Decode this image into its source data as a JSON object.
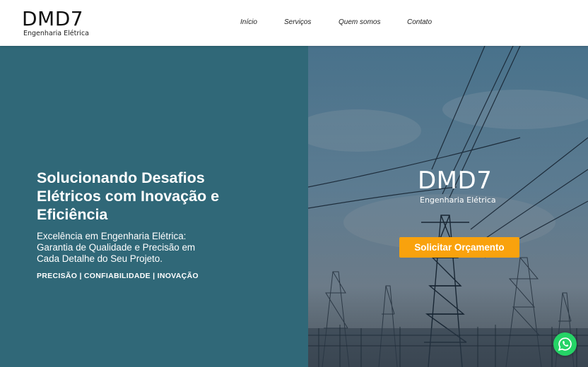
{
  "header": {
    "logo": {
      "title": "DMD7",
      "subtitle": "Engenharia Elétrica"
    },
    "nav": [
      {
        "label": "Início"
      },
      {
        "label": "Serviços"
      },
      {
        "label": "Quem somos"
      },
      {
        "label": "Contato"
      }
    ]
  },
  "hero": {
    "headline": "Solucionando Desafios Elétricos com Inovação e Eficiência",
    "subtext": "Excelência em Engenharia Elétrica: Garantia de Qualidade e Precisão em Cada Detalhe do Seu Projeto.",
    "tagline": "PRECISÃO | CONFIABILIDADE | INOVAÇÃO",
    "image_logo": {
      "title": "DMD7",
      "subtitle": "Engenharia Elétrica"
    },
    "cta_label": "Solicitar Orçamento"
  },
  "icons": {
    "whatsapp": "whatsapp-icon"
  },
  "colors": {
    "panel": "#306878",
    "cta": "#f9a20d",
    "whatsapp": "#25d366"
  }
}
